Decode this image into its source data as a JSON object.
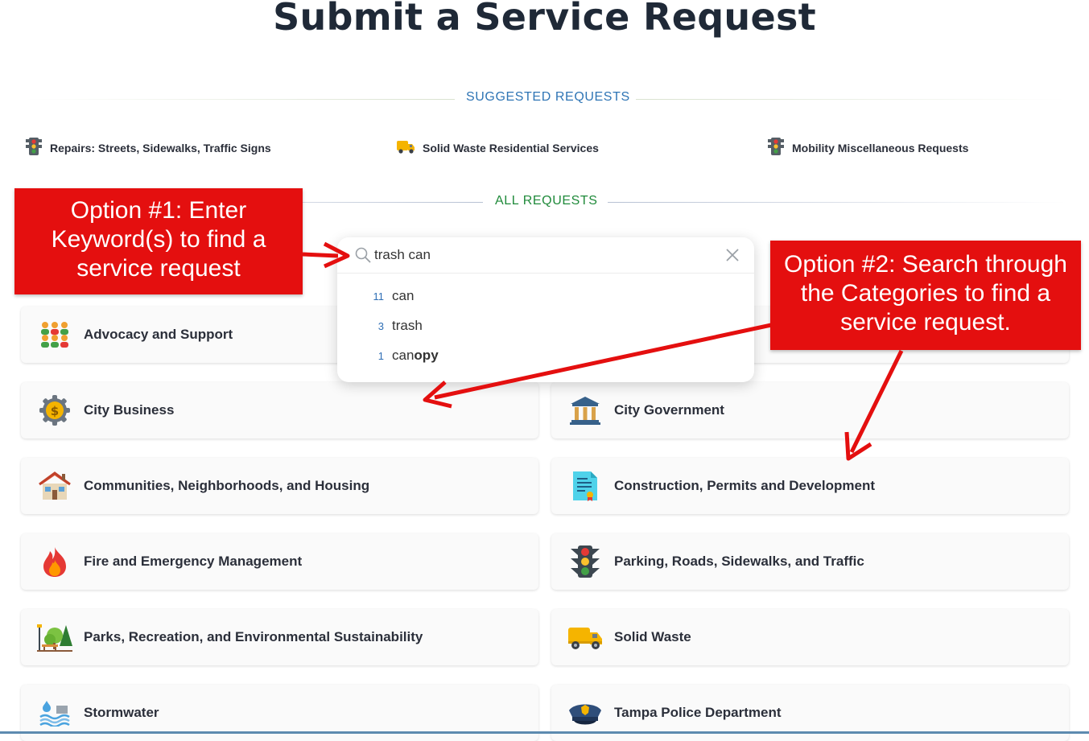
{
  "page": {
    "title": "Submit a Service Request"
  },
  "sections": {
    "suggested_label": "SUGGESTED REQUESTS",
    "all_label": "ALL REQUESTS"
  },
  "colors": {
    "suggested_label": "#2f75b5",
    "all_label": "#1f8a3a",
    "callout": "#e40f0f",
    "arrow": "#e40f0f",
    "title": "#1f2937"
  },
  "suggested": [
    {
      "label": "Repairs: Streets, Sidewalks, Traffic Signs",
      "icon": "traffic-light-icon"
    },
    {
      "label": "Solid Waste Residential Services",
      "icon": "garbage-truck-icon"
    },
    {
      "label": "Mobility Miscellaneous Requests",
      "icon": "traffic-light-icon"
    }
  ],
  "search": {
    "value": "trash can",
    "suggestions": [
      {
        "count": "11",
        "match": "can",
        "rest": ""
      },
      {
        "count": "3",
        "match": "trash",
        "rest": ""
      },
      {
        "count": "1",
        "match": "can",
        "rest": "opy"
      }
    ]
  },
  "categories": [
    {
      "label": "Advocacy and Support",
      "icon": "people-group-icon"
    },
    {
      "label": "",
      "icon": ""
    },
    {
      "label": "City Business",
      "icon": "gear-coin-icon"
    },
    {
      "label": "City Government",
      "icon": "government-building-icon"
    },
    {
      "label": "Communities, Neighborhoods, and Housing",
      "icon": "house-icon"
    },
    {
      "label": "Construction, Permits and Development",
      "icon": "permit-document-icon"
    },
    {
      "label": "Fire and Emergency Management",
      "icon": "fire-icon"
    },
    {
      "label": "Parking, Roads, Sidewalks, and Traffic",
      "icon": "traffic-light-icon"
    },
    {
      "label": "Parks, Recreation, and Environmental Sustainability",
      "icon": "park-tree-icon"
    },
    {
      "label": "Solid Waste",
      "icon": "garbage-truck-icon"
    },
    {
      "label": "Stormwater",
      "icon": "stormwater-icon"
    },
    {
      "label": "Tampa Police Department",
      "icon": "police-cap-icon"
    }
  ],
  "callouts": {
    "option1": "Option #1: Enter Keyword(s) to find a service request",
    "option2": "Option #2: Search through the Categories to find a service request."
  }
}
